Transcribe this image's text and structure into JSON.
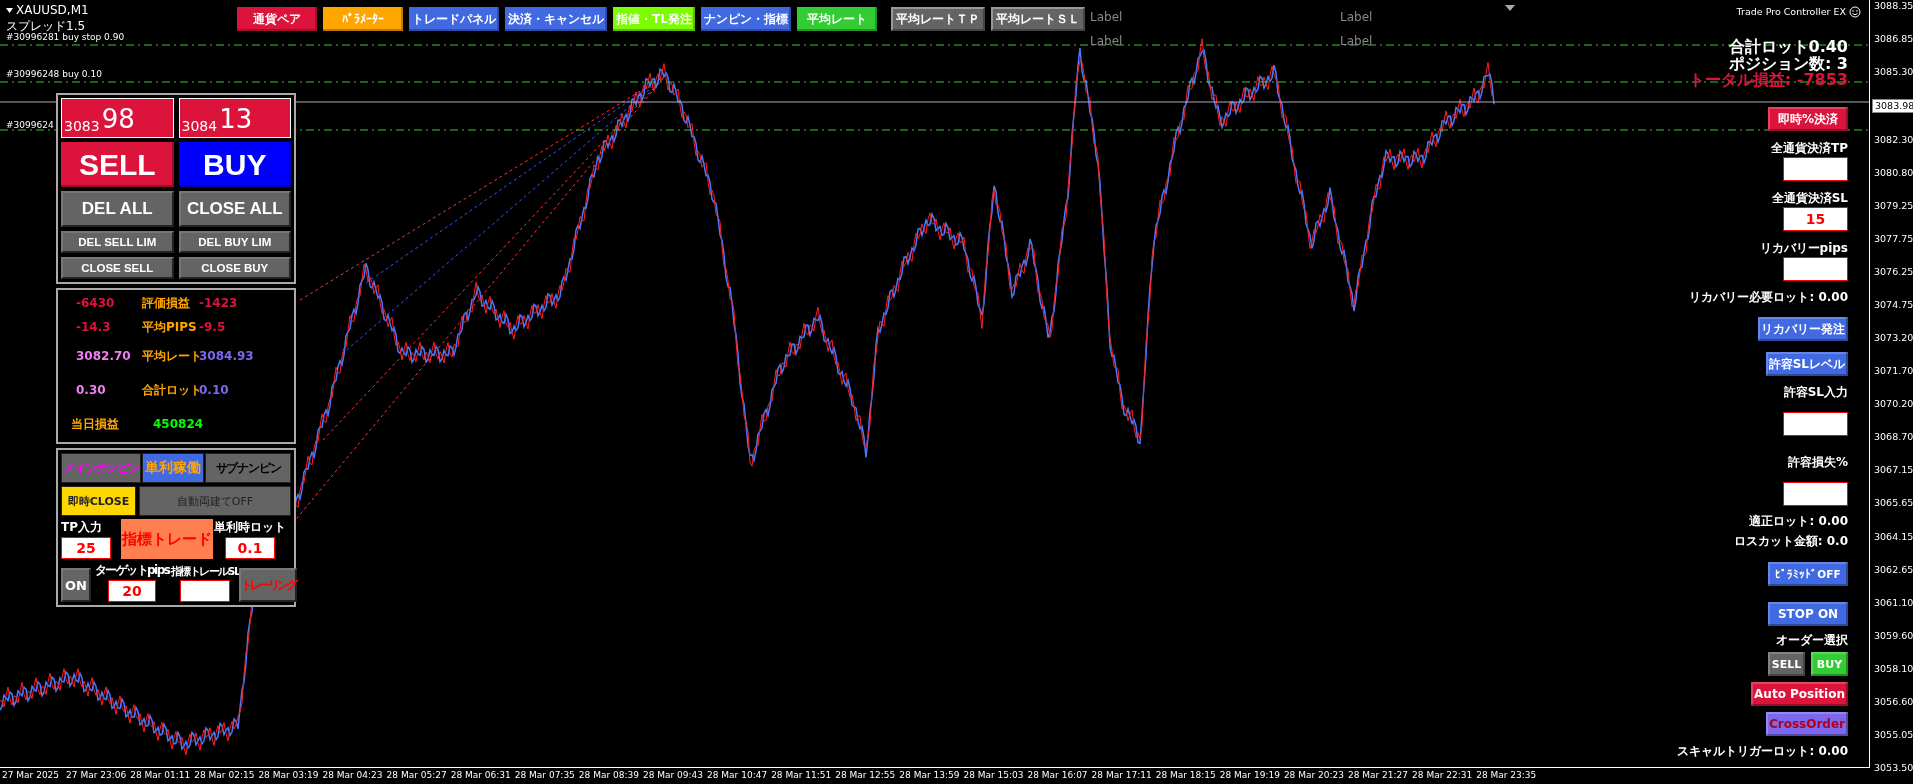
{
  "symbol": {
    "title": "XAUUSD,M1",
    "spread": "スプレッド1.5"
  },
  "top_buttons": [
    {
      "label": "通貨ペア",
      "kind": "menu",
      "color": "#dc143c"
    },
    {
      "label": "ﾊﾟﾗﾒｰﾀｰ",
      "kind": "menu",
      "color": "#ffa500"
    },
    {
      "label": "トレードパネル",
      "kind": "menu",
      "color": "#4169e1"
    },
    {
      "label": "決済・キャンセル",
      "kind": "menu",
      "color": "#4169e1"
    },
    {
      "label": "指値・TL発注",
      "kind": "menu",
      "color": "#7cfc00"
    },
    {
      "label": "ナンピン・指標",
      "kind": "menu",
      "color": "#4169e1"
    },
    {
      "label": "平均レート",
      "kind": "menu",
      "color": "#32cd32"
    },
    {
      "label": "平均レートＴＰ",
      "kind": "rate",
      "color": "#646464"
    },
    {
      "label": "平均レートＳＬ",
      "kind": "rate",
      "color": "#646464"
    }
  ],
  "chart_labels": [
    "Label",
    "Label",
    "Label",
    "Label"
  ],
  "brand": "Trade Pro Controller EX",
  "order_lines": [
    {
      "label": "#30996281 buy stop 0.90"
    },
    {
      "label": "#30996248 buy 0.10"
    },
    {
      "label": "#3099624"
    }
  ],
  "price_axis": [
    {
      "label": "3088.35",
      "current": false
    },
    {
      "label": "3086.85",
      "current": false
    },
    {
      "label": "3085.30",
      "current": false
    },
    {
      "label": "3083.98",
      "current": true
    },
    {
      "label": "3082.30",
      "current": false
    },
    {
      "label": "3080.80",
      "current": false
    },
    {
      "label": "3079.25",
      "current": false
    },
    {
      "label": "3077.75",
      "current": false
    },
    {
      "label": "3076.25",
      "current": false
    },
    {
      "label": "3074.75",
      "current": false
    },
    {
      "label": "3073.20",
      "current": false
    },
    {
      "label": "3071.70",
      "current": false
    },
    {
      "label": "3070.20",
      "current": false
    },
    {
      "label": "3068.70",
      "current": false
    },
    {
      "label": "3067.15",
      "current": false
    },
    {
      "label": "3065.65",
      "current": false
    },
    {
      "label": "3064.15",
      "current": false
    },
    {
      "label": "3062.65",
      "current": false
    },
    {
      "label": "3061.10",
      "current": false
    },
    {
      "label": "3059.60",
      "current": false
    },
    {
      "label": "3058.10",
      "current": false
    },
    {
      "label": "3056.60",
      "current": false
    },
    {
      "label": "3055.05",
      "current": false
    },
    {
      "label": "3053.50",
      "current": false
    }
  ],
  "time_axis": [
    "27 Mar 2025",
    "27 Mar 23:06",
    "28 Mar 01:11",
    "28 Mar 02:15",
    "28 Mar 03:19",
    "28 Mar 04:23",
    "28 Mar 05:27",
    "28 Mar 06:31",
    "28 Mar 07:35",
    "28 Mar 08:39",
    "28 Mar 09:43",
    "28 Mar 10:47",
    "28 Mar 11:51",
    "28 Mar 12:55",
    "28 Mar 13:59",
    "28 Mar 15:03",
    "28 Mar 16:07",
    "28 Mar 17:11",
    "28 Mar 18:15",
    "28 Mar 19:19",
    "28 Mar 20:23",
    "28 Mar 21:27",
    "28 Mar 22:31",
    "28 Mar 23:35"
  ],
  "trade_panel": {
    "quotes": [
      {
        "small": "3083",
        "big": "98"
      },
      {
        "small": "3084",
        "big": "13"
      }
    ],
    "order_buttons": [
      {
        "label": "SELL",
        "color": "#dc143c"
      },
      {
        "label": "BUY",
        "color": "#0000ff"
      }
    ],
    "action_buttons": [
      "DEL ALL",
      "CLOSE ALL"
    ],
    "small_buttons": [
      "DEL SELL LIM",
      "DEL BUY LIM",
      "CLOSE SELL",
      "CLOSE BUY"
    ]
  },
  "stats": [
    {
      "cells": [
        {
          "text": "-6430",
          "color": "#dc143c"
        },
        {
          "text": "評価損益",
          "color": "#ffa500"
        },
        {
          "text": "-1423",
          "color": "#dc143c"
        }
      ]
    },
    {
      "cells": [
        {
          "text": "-14.3",
          "color": "#dc143c"
        },
        {
          "text": "平均PIPS",
          "color": "#ffa500"
        },
        {
          "text": "-9.5",
          "color": "#dc143c"
        }
      ]
    },
    {
      "cells": [
        {
          "text": "3082.70",
          "color": "#ee82ee"
        },
        {
          "text": "平均レート",
          "color": "#ffa500"
        },
        {
          "text": "3084.93",
          "color": "#7b68ee"
        }
      ]
    },
    {
      "cells": [
        {
          "text": "0.30",
          "color": "#ee82ee"
        },
        {
          "text": "合計ロット",
          "color": "#ffa500"
        },
        {
          "text": "0.10",
          "color": "#7b68ee"
        }
      ]
    },
    {
      "cells": [
        {
          "text": "当日損益",
          "color": "#ffa500"
        },
        {
          "text": "450824",
          "color": "#00ff00"
        }
      ]
    }
  ],
  "nanpin_panel": {
    "modes": [
      {
        "label": "メインナンピン",
        "kind": "main",
        "on": false
      },
      {
        "label": "単利稼働",
        "kind": "profit",
        "on": true
      },
      {
        "label": "サブナンピン",
        "kind": "sub",
        "on": false
      }
    ],
    "toggles": [
      {
        "label": "即時CLOSE",
        "on": true
      },
      {
        "label": "自動両建てOFF",
        "on": false
      }
    ],
    "tp": {
      "label": "TP入力",
      "value": "25"
    },
    "signal_button": "指標トレード",
    "lot": {
      "label": "単利時ロット",
      "value": "0.1"
    },
    "on_button": "ON",
    "target": {
      "label": "ターゲットpips",
      "value": "20"
    },
    "trail": {
      "label": "指標トレールSL"
    },
    "trailing_button": "トレーリング"
  },
  "right_panel": [
    {
      "kind": "heading",
      "text": "合計ロット0.40"
    },
    {
      "kind": "heading",
      "text": "ポジション数: 3"
    },
    {
      "kind": "alert",
      "text": "トータル損益: -7853"
    },
    {
      "kind": "button",
      "label": "即時%決済",
      "color": "#dc143c"
    },
    {
      "kind": "label",
      "text": "全通貨決済TP"
    },
    {
      "kind": "field"
    },
    {
      "kind": "label",
      "text": "全通貨決済SL"
    },
    {
      "kind": "field",
      "value": "15"
    },
    {
      "kind": "label",
      "text": "リカバリーpips"
    },
    {
      "kind": "field"
    },
    {
      "kind": "label",
      "text": "リカバリー必要ロット: 0.00"
    },
    {
      "kind": "button",
      "label": "リカバリー発注",
      "color": "#4169e1"
    },
    {
      "kind": "button",
      "label": "許容SLレベル",
      "color": "#4169e1"
    },
    {
      "kind": "label",
      "text": "許容SL入力"
    },
    {
      "kind": "field"
    },
    {
      "kind": "label",
      "text": "許容損失%"
    },
    {
      "kind": "field"
    },
    {
      "kind": "label",
      "text": "適正ロット:  0.00"
    },
    {
      "kind": "label",
      "text": "ロスカット金額: 0.0"
    },
    {
      "kind": "small_button",
      "label": "ﾋﾟﾗﾐｯﾄﾞOFF",
      "color": "#4169e1"
    },
    {
      "kind": "button",
      "label": "STOP ON",
      "color": "#4169e1"
    },
    {
      "kind": "label",
      "text": "オーダー選択"
    },
    {
      "kind": "pair",
      "buttons": [
        {
          "label": "SELL",
          "color": "#646464"
        },
        {
          "label": "BUY",
          "color": "#32cd32"
        }
      ]
    },
    {
      "kind": "button",
      "label": "Auto Position",
      "color": "#dc143c"
    },
    {
      "kind": "cross_button",
      "label": "CrossOrder",
      "color": "#7b68ee"
    },
    {
      "kind": "label",
      "text": "スキャルトリガーロット: 0.00"
    }
  ]
}
